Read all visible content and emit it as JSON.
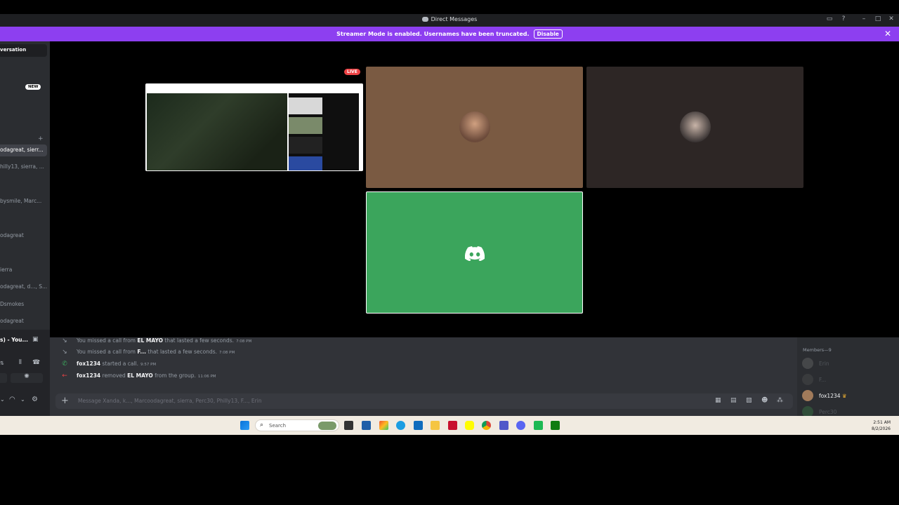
{
  "window": {
    "title": "Direct Messages"
  },
  "banner": {
    "message": "Streamer Mode is enabled. Usernames have been truncated.",
    "button": "Disable"
  },
  "sidebar": {
    "conversation_label": "versation",
    "new_badge": "NEW",
    "dms": [
      {
        "label": "odagreat, sierr..."
      },
      {
        "label": "hilly13, sierra, ..."
      },
      {
        "label": "bysmile, Marc..."
      },
      {
        "label": "odagreat"
      },
      {
        "label": "ierra"
      },
      {
        "label": "odagreat, d..., S..."
      },
      {
        "label": "Dsmokes"
      },
      {
        "label": "odagreat"
      }
    ],
    "voice_status": "s) - You..."
  },
  "stage": {
    "live_badge": "LIVE"
  },
  "chat": {
    "messages": [
      {
        "pre": "You missed a call from ",
        "name": "EL MAYO",
        "post": " that lasted a few seconds.",
        "time": "7:08 PM"
      },
      {
        "pre": "You missed a call from ",
        "name": "F...",
        "post": " that lasted a few seconds.",
        "time": "7:08 PM"
      },
      {
        "pre": "",
        "name": "fox1234",
        "post": " started a call.",
        "time": "9:57 PM"
      },
      {
        "pre": "",
        "name": "fox1234",
        "post": " removed ",
        "name2": "EL MAYO",
        "post2": " from the group.",
        "time": "11:06 PM"
      }
    ],
    "placeholder": "Message Xanda, k..., Marcoodagreat, sierra, Perc30, Philly13, F..., Erin"
  },
  "members": {
    "header": "Members—9",
    "list": [
      {
        "name": "Erin"
      },
      {
        "name": "F..."
      },
      {
        "name": "fox1234"
      },
      {
        "name": "Perc30"
      }
    ]
  },
  "taskbar": {
    "search": "Search",
    "time": "2:51 AM",
    "date": "8/2/2026"
  },
  "colors": {
    "streamer_banner": "#8d3ff0",
    "discord_tile": "#3ba55c",
    "live_red": "#ed4245",
    "call_green": "#3ba55c"
  }
}
